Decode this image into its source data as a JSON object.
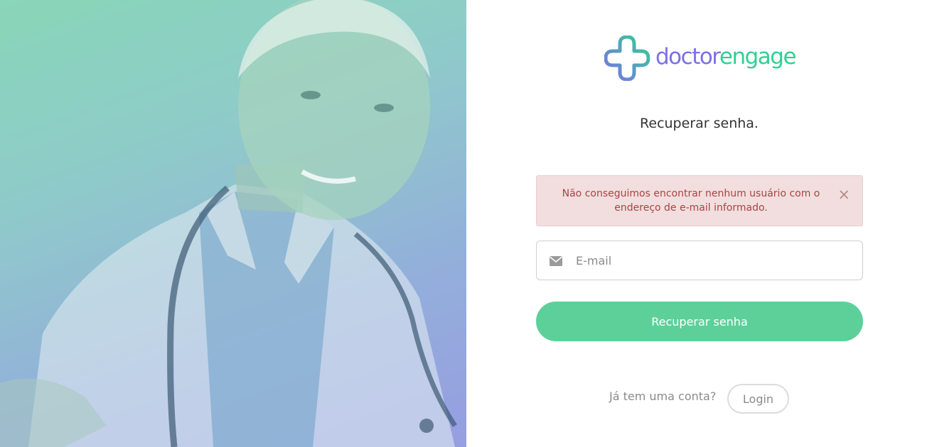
{
  "brand": {
    "name_part1": "doctor",
    "name_part2": "engage",
    "color_primary": "#7b6fe8",
    "color_secondary": "#33cf94"
  },
  "hero": {
    "image": "doctor-photo",
    "overlay_gradient": [
      "#7fd3b2",
      "#8e96e0"
    ]
  },
  "form": {
    "heading": "Recuperar senha.",
    "alert": {
      "message": "Não conseguimos encontrar nenhum usuário com o endereço de e-mail informado.",
      "close": "×",
      "background": "#f2dede",
      "text_color": "#a94442"
    },
    "email": {
      "icon": "envelope-icon",
      "placeholder": "E-mail",
      "value": ""
    },
    "submit_label": "Recuperar senha",
    "submit_color": "#5dd09a"
  },
  "footer": {
    "prompt": "Já tem uma conta?",
    "login_label": "Login"
  }
}
